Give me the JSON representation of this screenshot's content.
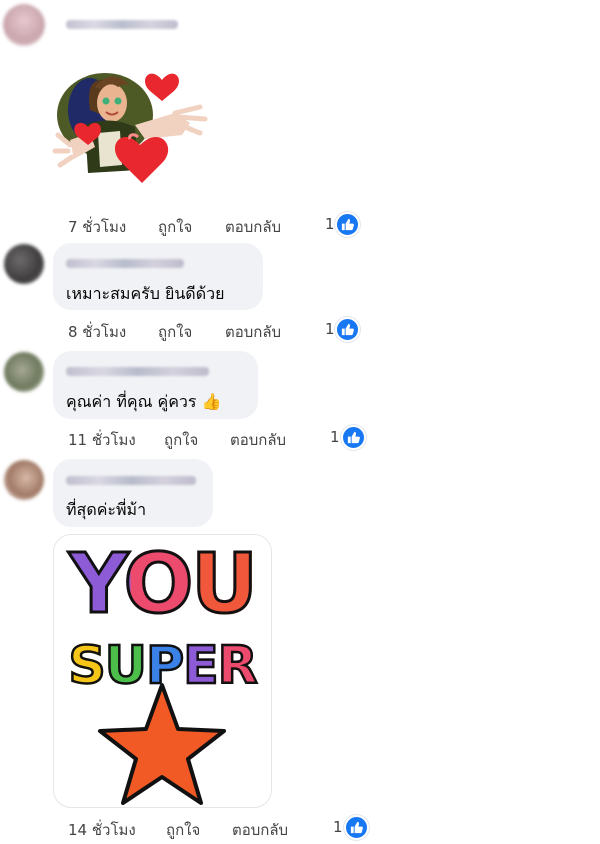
{
  "comments": [
    {
      "time": "7 ชั่วโมง",
      "like_label": "ถูกใจ",
      "reply_label": "ตอบกลับ",
      "reaction_count": "1",
      "text": ""
    },
    {
      "time": "8 ชั่วโมง",
      "like_label": "ถูกใจ",
      "reply_label": "ตอบกลับ",
      "reaction_count": "1",
      "text": "เหมาะสมครับ ยินดีด้วย"
    },
    {
      "time": "11 ชั่วโมง",
      "like_label": "ถูกใจ",
      "reply_label": "ตอบกลับ",
      "reaction_count": "1",
      "text": "คุณค่า ที่คุณ คู่ควร",
      "emoji": "👍"
    },
    {
      "time": "14 ชั่วโมง",
      "like_label": "ถูกใจ",
      "reply_label": "ตอบกลับ",
      "reaction_count": "1",
      "text": "ที่สุดค่ะพี่ม้า"
    }
  ],
  "sticker_super": {
    "line1": "YOU",
    "line2": "SUPER"
  },
  "colors": {
    "bubble": "#f0f2f5",
    "like_blue": "#1877f2",
    "action_text": "#444444"
  }
}
